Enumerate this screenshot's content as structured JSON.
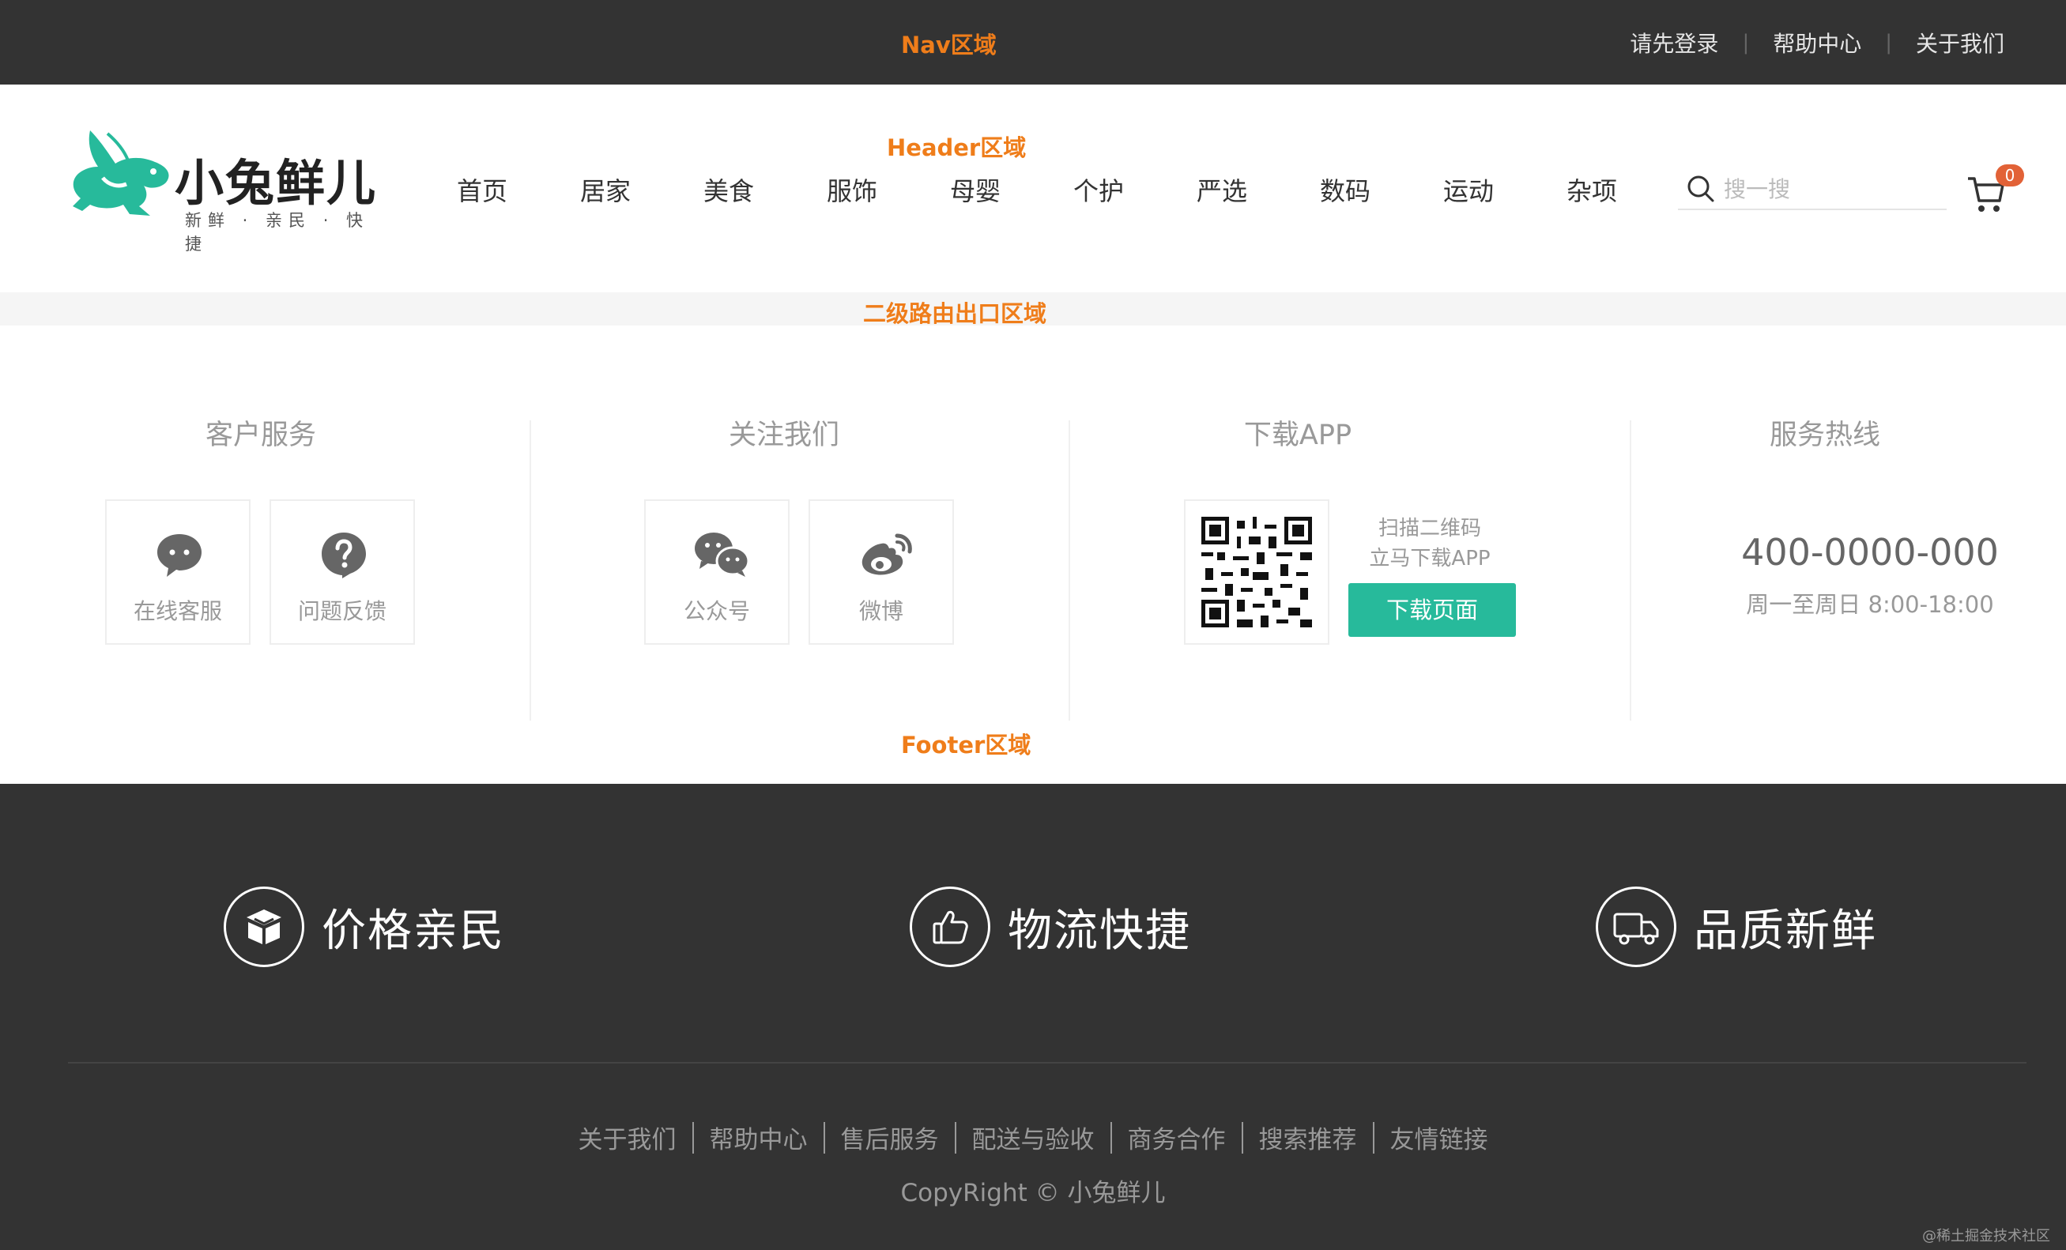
{
  "annotations": {
    "nav": "Nav区域",
    "header": "Header区域",
    "outlet": "二级路由出口区域",
    "footer": "Footer区域"
  },
  "topnav": {
    "links": [
      "请先登录",
      "帮助中心",
      "关于我们"
    ],
    "separator": "|"
  },
  "header": {
    "logo_text": "小兔鲜儿",
    "logo_slogan": "新鲜 · 亲民 · 快捷",
    "menu": [
      "首页",
      "居家",
      "美食",
      "服饰",
      "母婴",
      "个护",
      "严选",
      "数码",
      "运动",
      "杂项"
    ],
    "search_placeholder": "搜一搜",
    "cart_count": "0",
    "icons": {
      "search": "search-icon",
      "cart": "cart-icon"
    },
    "colors": {
      "brand": "#27ba9b",
      "badge": "#e26237"
    }
  },
  "contact": {
    "customer_service": {
      "title": "客户服务",
      "items": [
        {
          "label": "在线客服",
          "icon": "chat-bubble-icon"
        },
        {
          "label": "问题反馈",
          "icon": "question-icon"
        }
      ]
    },
    "follow_us": {
      "title": "关注我们",
      "items": [
        {
          "label": "公众号",
          "icon": "wechat-icon"
        },
        {
          "label": "微博",
          "icon": "weibo-icon"
        }
      ]
    },
    "download_app": {
      "title": "下载APP",
      "qr_line1": "扫描二维码",
      "qr_line2": "立马下载APP",
      "button": "下载页面"
    },
    "hotline": {
      "title": "服务热线",
      "phone": "400-0000-000",
      "hours": "周一至周日 8:00-18:00"
    }
  },
  "bottom": {
    "promises": [
      {
        "label": "价格亲民",
        "icon": "box-icon"
      },
      {
        "label": "物流快捷",
        "icon": "thumbs-up-icon"
      },
      {
        "label": "品质新鲜",
        "icon": "truck-icon"
      }
    ],
    "links": [
      "关于我们",
      "帮助中心",
      "售后服务",
      "配送与验收",
      "商务合作",
      "搜索推荐",
      "友情链接"
    ],
    "copyright": "CopyRight © 小兔鲜儿",
    "watermark": "@稀土掘金技术社区"
  }
}
